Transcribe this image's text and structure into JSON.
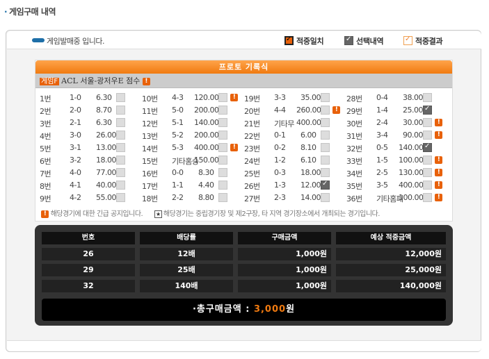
{
  "title": "게임구매 내역",
  "status": "게임발매중 입니다.",
  "legend": {
    "hit": "적중일치",
    "selected": "선택내역",
    "result": "적중결과"
  },
  "proto": {
    "header": "프로토 기록식",
    "tag": "게임F",
    "game_title": "ACL 서울-광저우E 점수"
  },
  "colors": {
    "accent": "#f07a10",
    "status_pill": "#1e6fa8"
  },
  "columns": [
    [
      {
        "no": "1번",
        "score": "1-0",
        "odds": "6.30",
        "checked": false,
        "notice": false
      },
      {
        "no": "2번",
        "score": "2-0",
        "odds": "8.70",
        "checked": false,
        "notice": false
      },
      {
        "no": "3번",
        "score": "2-1",
        "odds": "6.30",
        "checked": false,
        "notice": false
      },
      {
        "no": "4번",
        "score": "3-0",
        "odds": "26.00",
        "checked": false,
        "notice": false
      },
      {
        "no": "5번",
        "score": "3-1",
        "odds": "13.00",
        "checked": false,
        "notice": false
      },
      {
        "no": "6번",
        "score": "3-2",
        "odds": "18.00",
        "checked": false,
        "notice": false
      },
      {
        "no": "7번",
        "score": "4-0",
        "odds": "77.00",
        "checked": false,
        "notice": false
      },
      {
        "no": "8번",
        "score": "4-1",
        "odds": "40.00",
        "checked": false,
        "notice": false
      },
      {
        "no": "9번",
        "score": "4-2",
        "odds": "55.00",
        "checked": false,
        "notice": false
      }
    ],
    [
      {
        "no": "10번",
        "score": "4-3",
        "odds": "120.00",
        "checked": false,
        "notice": true
      },
      {
        "no": "11번",
        "score": "5-0",
        "odds": "200.00",
        "checked": false,
        "notice": false
      },
      {
        "no": "12번",
        "score": "5-1",
        "odds": "140.00",
        "checked": false,
        "notice": false
      },
      {
        "no": "13번",
        "score": "5-2",
        "odds": "200.00",
        "checked": false,
        "notice": false
      },
      {
        "no": "14번",
        "score": "5-3",
        "odds": "400.00",
        "checked": false,
        "notice": true
      },
      {
        "no": "15번",
        "score": "기타홈승",
        "odds": "150.00",
        "checked": false,
        "notice": false
      },
      {
        "no": "16번",
        "score": "0-0",
        "odds": "8.30",
        "checked": false,
        "notice": false
      },
      {
        "no": "17번",
        "score": "1-1",
        "odds": "4.40",
        "checked": false,
        "notice": false
      },
      {
        "no": "18번",
        "score": "2-2",
        "odds": "8.80",
        "checked": false,
        "notice": false
      }
    ],
    [
      {
        "no": "19번",
        "score": "3-3",
        "odds": "35.00",
        "checked": false,
        "notice": false
      },
      {
        "no": "20번",
        "score": "4-4",
        "odds": "260.00",
        "checked": false,
        "notice": true
      },
      {
        "no": "21번",
        "score": "기타무",
        "odds": "400.00",
        "checked": false,
        "notice": false
      },
      {
        "no": "22번",
        "score": "0-1",
        "odds": "6.00",
        "checked": false,
        "notice": false
      },
      {
        "no": "23번",
        "score": "0-2",
        "odds": "8.10",
        "checked": false,
        "notice": false
      },
      {
        "no": "24번",
        "score": "1-2",
        "odds": "6.10",
        "checked": false,
        "notice": false
      },
      {
        "no": "25번",
        "score": "0-3",
        "odds": "18.00",
        "checked": false,
        "notice": false
      },
      {
        "no": "26번",
        "score": "1-3",
        "odds": "12.00",
        "checked": true,
        "notice": false
      },
      {
        "no": "27번",
        "score": "2-3",
        "odds": "14.00",
        "checked": false,
        "notice": false
      }
    ],
    [
      {
        "no": "28번",
        "score": "0-4",
        "odds": "38.00",
        "checked": false,
        "notice": false
      },
      {
        "no": "29번",
        "score": "1-4",
        "odds": "25.00",
        "checked": true,
        "notice": false
      },
      {
        "no": "30번",
        "score": "2-4",
        "odds": "30.00",
        "checked": false,
        "notice": true
      },
      {
        "no": "31번",
        "score": "3-4",
        "odds": "90.00",
        "checked": false,
        "notice": true
      },
      {
        "no": "32번",
        "score": "0-5",
        "odds": "140.00",
        "checked": true,
        "notice": false
      },
      {
        "no": "33번",
        "score": "1-5",
        "odds": "100.00",
        "checked": false,
        "notice": true
      },
      {
        "no": "34번",
        "score": "2-5",
        "odds": "130.00",
        "checked": false,
        "notice": true
      },
      {
        "no": "35번",
        "score": "3-5",
        "odds": "400.00",
        "checked": false,
        "notice": true
      },
      {
        "no": "36번",
        "score": "기타홈패",
        "odds": "100.00",
        "checked": false,
        "notice": true
      }
    ]
  ],
  "notes": {
    "notice": "해당경기에 대한 긴급 공지입니다.",
    "star": "해당경기는 중립경기장 및 제2구장, 타 지역 경기장소에서 개최되는 경기입니다."
  },
  "summary": {
    "headers": [
      "번호",
      "배당률",
      "구매금액",
      "예상 적중금액"
    ],
    "rows": [
      [
        "26",
        "12배",
        "1,000원",
        "12,000원"
      ],
      [
        "29",
        "25배",
        "1,000원",
        "25,000원"
      ],
      [
        "32",
        "140배",
        "1,000원",
        "140,000원"
      ]
    ],
    "total_label": "·총구매금액 : ",
    "total_amount": "3,000",
    "total_unit": "원"
  }
}
